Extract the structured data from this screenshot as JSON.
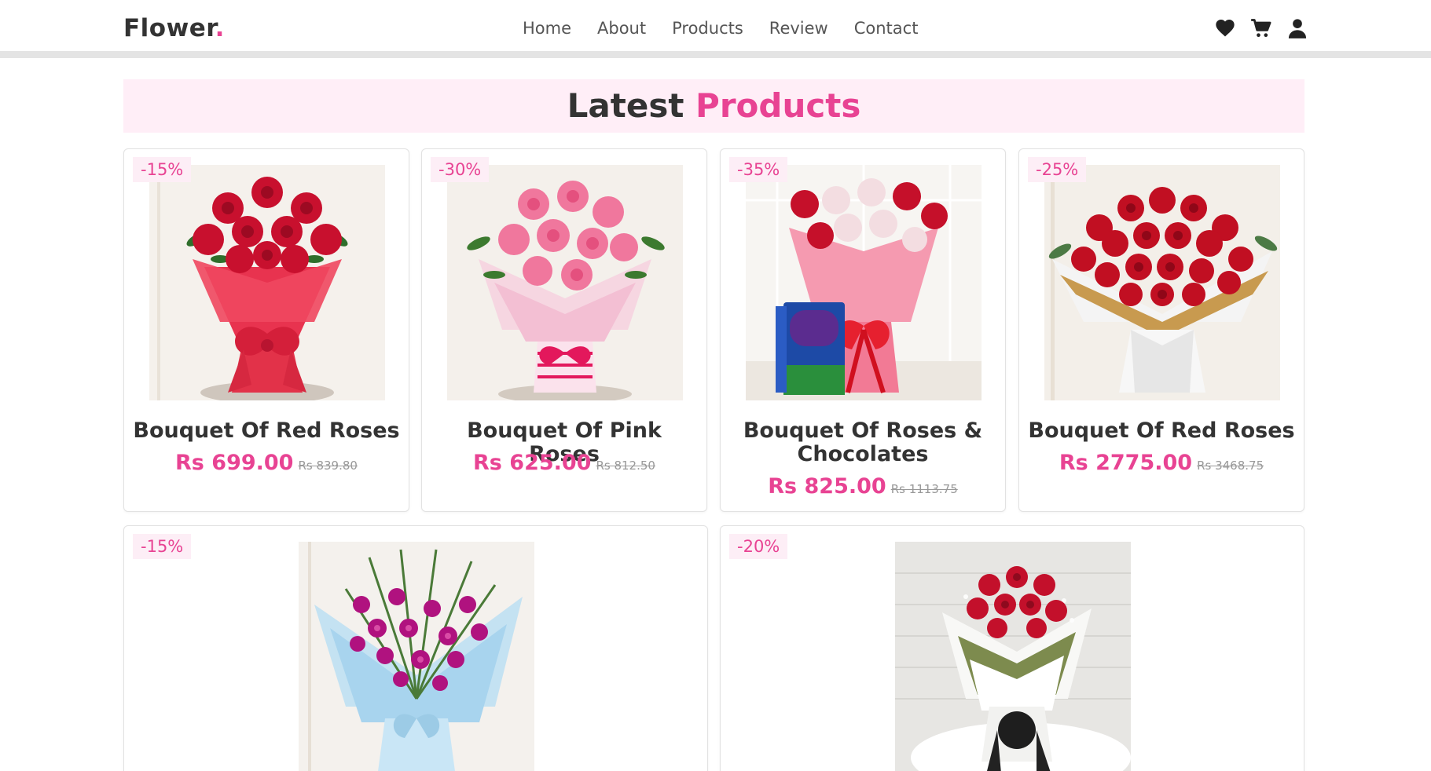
{
  "brand": {
    "name": "Flower",
    "dot": "."
  },
  "nav": [
    {
      "label": "Home"
    },
    {
      "label": "About"
    },
    {
      "label": "Products"
    },
    {
      "label": "Review"
    },
    {
      "label": "Contact"
    }
  ],
  "header_icons": [
    "heart-icon",
    "cart-icon",
    "user-icon"
  ],
  "section": {
    "title_main": "Latest",
    "title_accent": "Products"
  },
  "colors": {
    "accent": "#e84393",
    "band": "#ffeef7",
    "badge_bg": "#fdeef6"
  },
  "products": [
    {
      "discount": "-15%",
      "name": "Bouquet Of Red Roses",
      "price": "Rs 699.00",
      "old_price": "Rs 839.80"
    },
    {
      "discount": "-30%",
      "name": "Bouquet Of Pink Roses",
      "price": "Rs 625.00",
      "old_price": "Rs 812.50"
    },
    {
      "discount": "-35%",
      "name": "Bouquet Of Roses & Chocolates",
      "price": "Rs 825.00",
      "old_price": "Rs 1113.75"
    },
    {
      "discount": "-25%",
      "name": "Bouquet Of Red Roses",
      "price": "Rs 2775.00",
      "old_price": "Rs 3468.75"
    },
    {
      "discount": "-15%"
    },
    {
      "discount": "-20%"
    }
  ]
}
